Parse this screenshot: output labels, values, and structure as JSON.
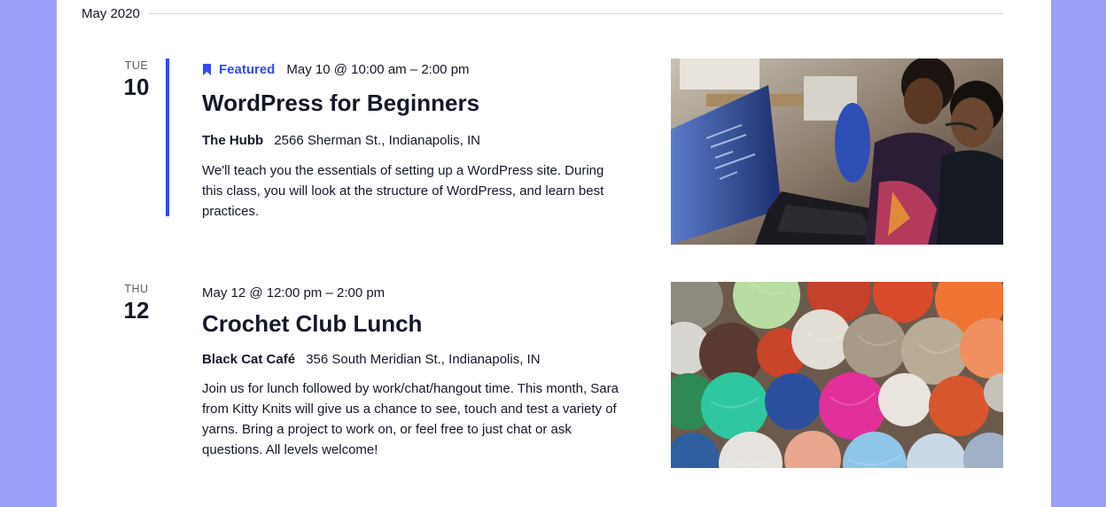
{
  "month_separator": {
    "label": "May 2020"
  },
  "events": [
    {
      "weekday": "TUE",
      "day": "10",
      "featured_label": "Featured",
      "datetime": "May 10 @ 10:00 am – 2:00 pm",
      "title": "WordPress for Beginners",
      "venue_name": "The Hubb",
      "venue_address": "2566 Sherman St., Indianapolis, IN",
      "description": "We'll teach you the essentials of setting up a WordPress site. During this class, you will look at the structure of WordPress, and learn best practices.",
      "image_icon": "people-at-laptop-photo"
    },
    {
      "weekday": "THU",
      "day": "12",
      "datetime": "May 12 @ 12:00 pm – 2:00 pm",
      "title": "Crochet Club Lunch",
      "venue_name": "Black Cat Café",
      "venue_address": "356 South Meridian St., Indianapolis, IN",
      "description": "Join us for lunch followed by work/chat/hangout time. This month, Sara from Kitty Knits will give us a chance to see, touch and test a variety of yarns. Bring a project to work on, or feel free to just chat or ask questions. All levels welcome!",
      "image_icon": "yarn-balls-photo"
    }
  ],
  "colors": {
    "accent": "#334aff",
    "page_background": "#9ba1fb",
    "text": "#141827"
  }
}
